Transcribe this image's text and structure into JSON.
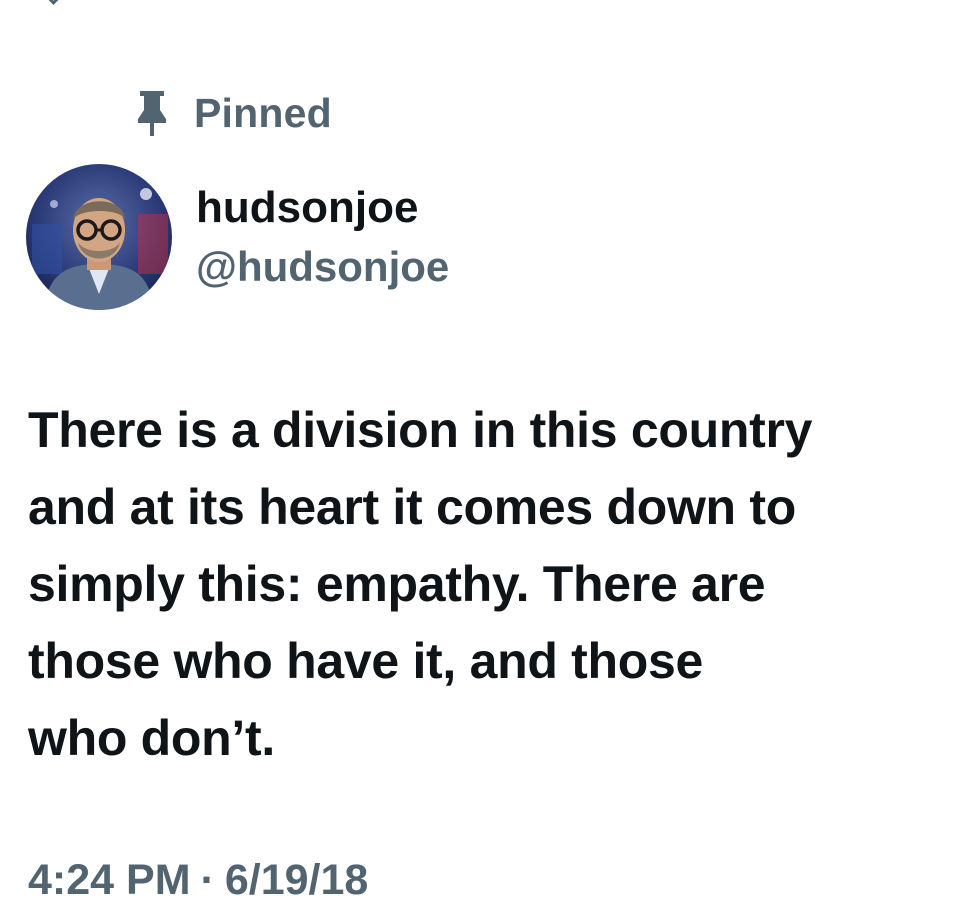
{
  "pinned": {
    "label": "Pinned",
    "icon": "pin-icon"
  },
  "author": {
    "display_name": "hudsonjoe",
    "handle": "@hudsonjoe",
    "avatar_icon": "avatar-photo"
  },
  "tweet": {
    "text": "There is a division in this country\nand at its heart it comes down to\nsimply this: empathy. There are\nthose who have it, and those\nwho don’t.",
    "time": "4:24 PM",
    "separator": "·",
    "date": "6/19/18"
  },
  "colors": {
    "primary_text": "#0f1419",
    "secondary_text": "#536471",
    "background": "#ffffff"
  }
}
